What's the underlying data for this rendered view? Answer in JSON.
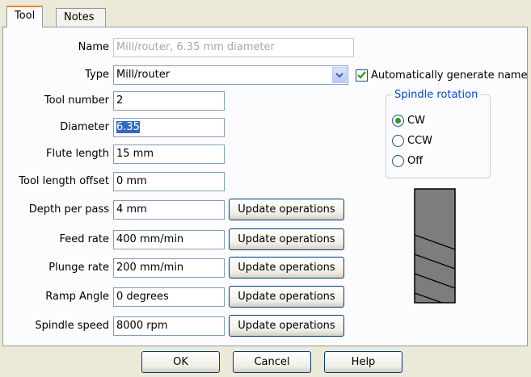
{
  "tabs": [
    {
      "label": "Tool",
      "active": true
    },
    {
      "label": "Notes",
      "active": false
    }
  ],
  "form": {
    "name_label": "Name",
    "name_value": "Mill/router, 6.35 mm diameter",
    "type_label": "Type",
    "type_value": "Mill/router",
    "auto_name_label": "Automatically generate name",
    "auto_name_checked": true,
    "tool_number_label": "Tool number",
    "tool_number_value": "2",
    "diameter_label": "Diameter",
    "diameter_value": "6.35",
    "flute_length_label": "Flute length",
    "flute_length_value": "15 mm",
    "tool_length_offset_label": "Tool length offset",
    "tool_length_offset_value": "0 mm",
    "depth_per_pass_label": "Depth per pass",
    "depth_per_pass_value": "4 mm",
    "feed_rate_label": "Feed rate",
    "feed_rate_value": "400 mm/min",
    "plunge_rate_label": "Plunge rate",
    "plunge_rate_value": "200 mm/min",
    "ramp_angle_label": "Ramp Angle",
    "ramp_angle_value": "0 degrees",
    "spindle_speed_label": "Spindle speed",
    "spindle_speed_value": "8000 rpm",
    "update_label": "Update operations"
  },
  "spindle": {
    "title": "Spindle rotation",
    "options": [
      "CW",
      "CCW",
      "Off"
    ],
    "selected": "CW"
  },
  "buttons": {
    "ok": "OK",
    "cancel": "Cancel",
    "help": "Help"
  },
  "colors": {
    "tab_accent": "#e68b2c",
    "group_title": "#0046d5",
    "selection": "#316ac5",
    "check": "#21a121"
  },
  "icons": [
    "checkmark-icon",
    "chevron-down-icon",
    "tool-preview-icon"
  ]
}
